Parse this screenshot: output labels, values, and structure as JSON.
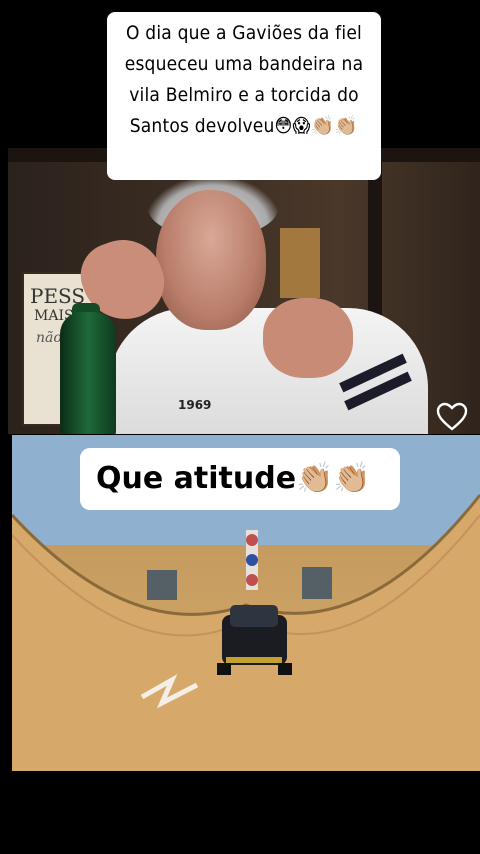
{
  "top_caption": {
    "line1": "O dia que a Gaviões da fiel",
    "line2": "esqueceu uma bandeira na",
    "line3": "vila Belmiro  e a torcida do",
    "line4": "Santos devolveu😳😱👏🏼👏🏼"
  },
  "bottom_caption": {
    "text": "Que atitude👏🏼👏🏼"
  },
  "video_top": {
    "poster_line1": "PESS",
    "poster_line2": "MAIS",
    "poster_line3": "não",
    "jacket_text": "1969"
  },
  "icons": {
    "like": "heart-icon"
  },
  "colors": {
    "background": "#000000",
    "caption_bg": "#ffffff",
    "caption_text": "#000000"
  }
}
